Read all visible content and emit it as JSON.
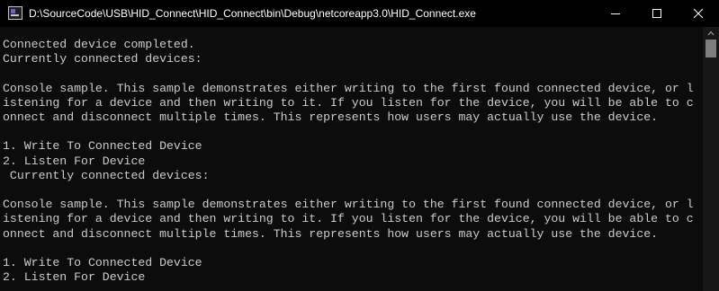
{
  "window": {
    "title": "D:\\SourceCode\\USB\\HID_Connect\\HID_Connect\\bin\\Debug\\netcoreapp3.0\\HID_Connect.exe",
    "icon": "console-app-icon",
    "controls": {
      "minimize": "minimize-icon",
      "maximize": "maximize-icon",
      "close": "close-icon"
    }
  },
  "console": {
    "lines": [
      "Connected device completed.",
      "Currently connected devices:",
      "",
      "Console sample. This sample demonstrates either writing to the first found connected device, or l",
      "istening for a device and then writing to it. If you listen for the device, you will be able to c",
      "onnect and disconnect multiple times. This represents how users may actually use the device.",
      "",
      "1. Write To Connected Device",
      "2. Listen For Device",
      " Currently connected devices:",
      "",
      "Console sample. This sample demonstrates either writing to the first found connected device, or l",
      "istening for a device and then writing to it. If you listen for the device, you will be able to c",
      "onnect and disconnect multiple times. This represents how users may actually use the device.",
      "",
      "1. Write To Connected Device",
      "2. Listen For Device"
    ]
  },
  "colors": {
    "titlebar_bg": "#000000",
    "console_bg": "#0c0c0c",
    "console_text": "#cccccc",
    "scrollbar_track": "#171717",
    "scrollbar_thumb": "#7e7e7e"
  }
}
